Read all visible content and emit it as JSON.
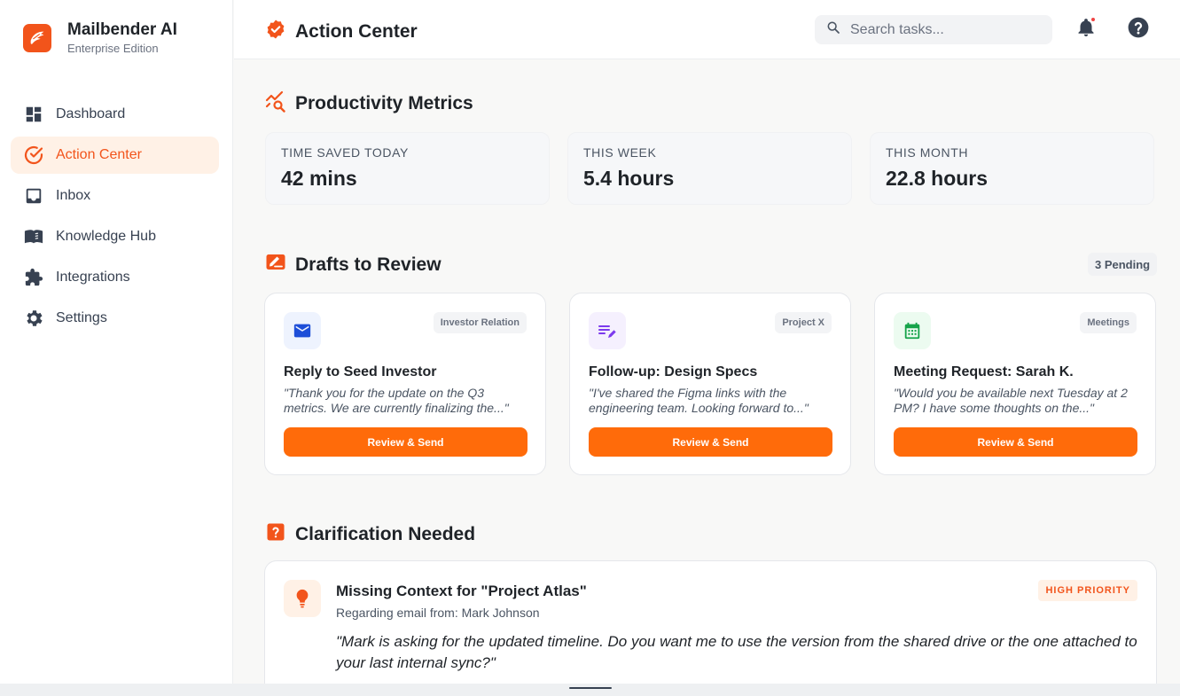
{
  "brand": {
    "name": "Mailbender AI",
    "edition": "Enterprise Edition"
  },
  "sidebar": {
    "items": [
      {
        "label": "Dashboard",
        "icon": "dashboard-icon",
        "active": false
      },
      {
        "label": "Action Center",
        "icon": "check-circle-icon",
        "active": true
      },
      {
        "label": "Inbox",
        "icon": "inbox-icon",
        "active": false
      },
      {
        "label": "Knowledge Hub",
        "icon": "book-icon",
        "active": false
      },
      {
        "label": "Integrations",
        "icon": "puzzle-icon",
        "active": false
      },
      {
        "label": "Settings",
        "icon": "gear-icon",
        "active": false
      }
    ]
  },
  "header": {
    "title": "Action Center",
    "search_placeholder": "Search tasks...",
    "search_value": ""
  },
  "metrics": {
    "title": "Productivity Metrics",
    "items": [
      {
        "label": "TIME SAVED TODAY",
        "value": "42 mins"
      },
      {
        "label": "THIS WEEK",
        "value": "5.4 hours"
      },
      {
        "label": "THIS MONTH",
        "value": "22.8 hours"
      }
    ]
  },
  "drafts": {
    "title": "Drafts to Review",
    "pending": "3 Pending",
    "items": [
      {
        "tag": "Investor Relation",
        "icon": "mail-icon",
        "title": "Reply to Seed Investor",
        "snippet": "\"Thank you for the update on the Q3 metrics. We are currently finalizing the...\"",
        "button": "Review & Send"
      },
      {
        "tag": "Project X",
        "icon": "edit-note-icon",
        "title": "Follow-up: Design Specs",
        "snippet": "\"I've shared the Figma links with the engineering team. Looking forward to...\"",
        "button": "Review & Send"
      },
      {
        "tag": "Meetings",
        "icon": "calendar-icon",
        "title": "Meeting Request: Sarah K.",
        "snippet": "\"Would you be available next Tuesday at 2 PM? I have some thoughts on the...\"",
        "button": "Review & Send"
      }
    ]
  },
  "clarification": {
    "title": "Clarification Needed",
    "item": {
      "title": "Missing Context for \"Project Atlas\"",
      "subtitle": "Regarding email from: Mark Johnson",
      "priority": "HIGH PRIORITY",
      "quote": "\"Mark is asking for the updated timeline. Do you want me to use the version from the shared drive or the one attached to your last internal sync?\""
    }
  },
  "colors": {
    "accent": "#f2541b",
    "button": "#ff6b0a",
    "mail": "#1d4ed8",
    "edit": "#7c3aed",
    "calendar": "#16a34a"
  }
}
